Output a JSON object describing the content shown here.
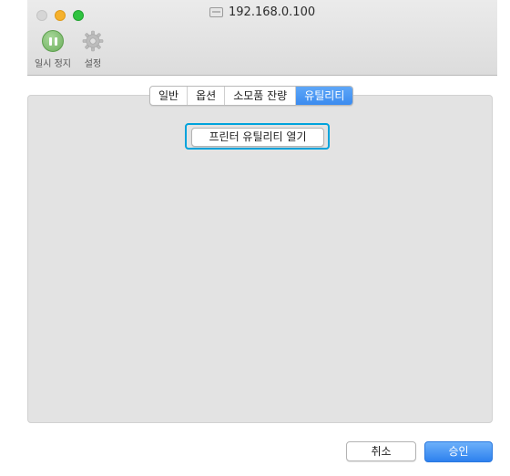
{
  "window": {
    "title": "192.168.0.100"
  },
  "toolbar": {
    "pause_label": "일시 정지",
    "settings_label": "설정"
  },
  "tabs": [
    {
      "label": "일반",
      "active": false
    },
    {
      "label": "옵션",
      "active": false
    },
    {
      "label": "소모품 잔량",
      "active": false
    },
    {
      "label": "유틸리티",
      "active": true
    }
  ],
  "utility": {
    "open_button_label": "프린터 유틸리티 열기"
  },
  "footer": {
    "cancel_label": "취소",
    "approve_label": "승인"
  },
  "colors": {
    "accent": "#3b8bef",
    "highlight": "#00a3dc"
  }
}
